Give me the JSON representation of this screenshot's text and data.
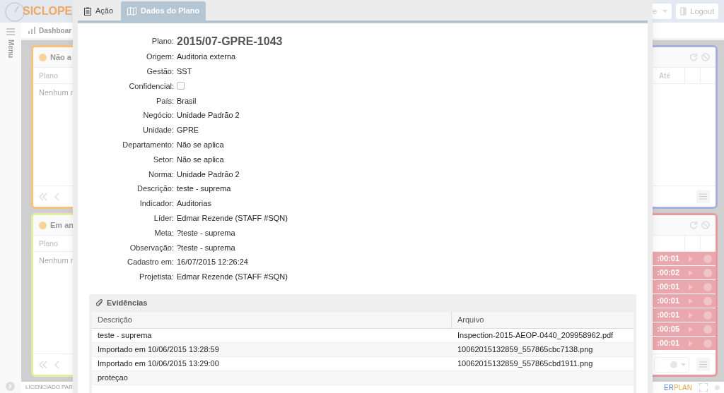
{
  "app": {
    "logo": "SICLOPE",
    "menu_label": "Menu",
    "breadcrumb": "Dashboar",
    "header_button": "e",
    "logout": "Logout",
    "footer_left": "LICENCIADO PAR",
    "brand_parts": [
      "ER",
      "PLAN"
    ]
  },
  "panels": [
    {
      "kind": "left",
      "color": "#f8c27c",
      "title": "Não a",
      "column": "Plano",
      "empty": "Nenhum r"
    },
    {
      "kind": "right",
      "color": "#aab0dd",
      "column": "Até"
    },
    {
      "kind": "left",
      "color": "#e4eda0",
      "title": "Em an",
      "column": "Plano",
      "empty": "Nenhum r"
    },
    {
      "kind": "right",
      "color": "#e89aa0",
      "rows": [
        ":00:01",
        ":00:02",
        ":00:01",
        ":00:01",
        ":00:01",
        ":00:05",
        ":00:01"
      ]
    }
  ],
  "modal": {
    "tabs": [
      {
        "label": "Ação",
        "selected": false
      },
      {
        "label": "Dados do Plano",
        "selected": true
      }
    ],
    "fields": [
      {
        "kind": "title",
        "label": "Plano:",
        "value": "2015/07-GPRE-1043"
      },
      {
        "kind": "text",
        "label": "Origem:",
        "value": "Auditoria externa"
      },
      {
        "kind": "text",
        "label": "Gestão:",
        "value": "SST"
      },
      {
        "kind": "checkbox",
        "label": "Confidencial:",
        "checked": false
      },
      {
        "kind": "text",
        "label": "País:",
        "value": "Brasil"
      },
      {
        "kind": "text",
        "label": "Negócio:",
        "value": "Unidade Padrão 2"
      },
      {
        "kind": "text",
        "label": "Unidade:",
        "value": "GPRE"
      },
      {
        "kind": "text",
        "label": "Departamento:",
        "value": "Não se aplica"
      },
      {
        "kind": "text",
        "label": "Setor:",
        "value": "Não se aplica"
      },
      {
        "kind": "text",
        "label": "Norma:",
        "value": "Unidade Padrão 2"
      },
      {
        "kind": "text",
        "label": "Descrição:",
        "value": "teste - suprema"
      },
      {
        "kind": "text",
        "label": "Indicador:",
        "value": "Auditorias"
      },
      {
        "kind": "text",
        "label": "Líder:",
        "value": "Edmar Rezende (STAFF #SQN)"
      },
      {
        "kind": "text",
        "label": "Meta:",
        "value": "?teste - suprema"
      },
      {
        "kind": "text",
        "label": "Observação:",
        "value": "?teste - suprema"
      },
      {
        "kind": "text",
        "label": "Cadastro em:",
        "value": "16/07/2015 12:26:24"
      },
      {
        "kind": "text",
        "label": "Projetista:",
        "value": "Edmar Rezende (STAFF #SQN)"
      }
    ],
    "evidence": {
      "title": "Evidências",
      "columns": [
        "Descrição",
        "Arquivo"
      ],
      "rows": [
        [
          "teste - suprema",
          "Inspection-2015-AEOP-0440_209958962.pdf"
        ],
        [
          "Importado em 10/06/2015 13:28:59",
          "10062015132859_557865cbc7138.png"
        ],
        [
          "Importado em 10/06/2015 13:29:00",
          "10062015132859_557865cbd1911.png"
        ],
        [
          "proteçao"
        ]
      ]
    }
  }
}
